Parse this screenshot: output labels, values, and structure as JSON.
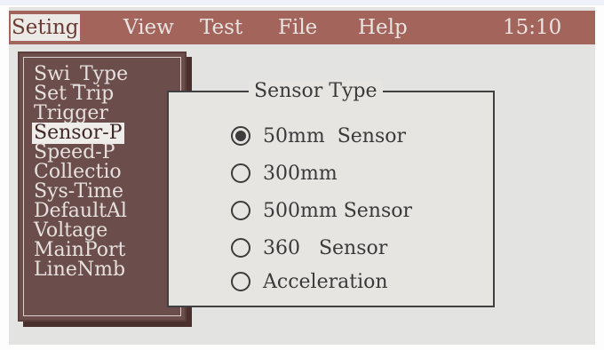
{
  "menu": {
    "items": [
      {
        "label": "Seting"
      },
      {
        "label": "View"
      },
      {
        "label": "Test"
      },
      {
        "label": "File"
      },
      {
        "label": "Help"
      }
    ],
    "clock": "15:10"
  },
  "settings": {
    "items": [
      {
        "label": "Swi_Type"
      },
      {
        "label": "Set Trip"
      },
      {
        "label": "Trigger"
      },
      {
        "label": "Sensor-P"
      },
      {
        "label": "Speed-P"
      },
      {
        "label": "Collectio"
      },
      {
        "label": "Sys-Time"
      },
      {
        "label": "DefaultAl"
      },
      {
        "label": "Voltage"
      },
      {
        "label": "MainPort"
      },
      {
        "label": "LineNmb"
      }
    ],
    "selected": "Sensor-P"
  },
  "dialog": {
    "title": "Sensor Type",
    "options": [
      {
        "label": "50mm  Sensor",
        "checked": true
      },
      {
        "label": "300mm",
        "checked": false
      },
      {
        "label": "500mm Sensor",
        "checked": false
      },
      {
        "label": "360   Sensor",
        "checked": false
      },
      {
        "label": "Acceleration",
        "checked": false
      }
    ]
  },
  "colors": {
    "menubar": "#a2645b",
    "list_background": "#6b4e4b",
    "screen": "#e3e3e1"
  }
}
